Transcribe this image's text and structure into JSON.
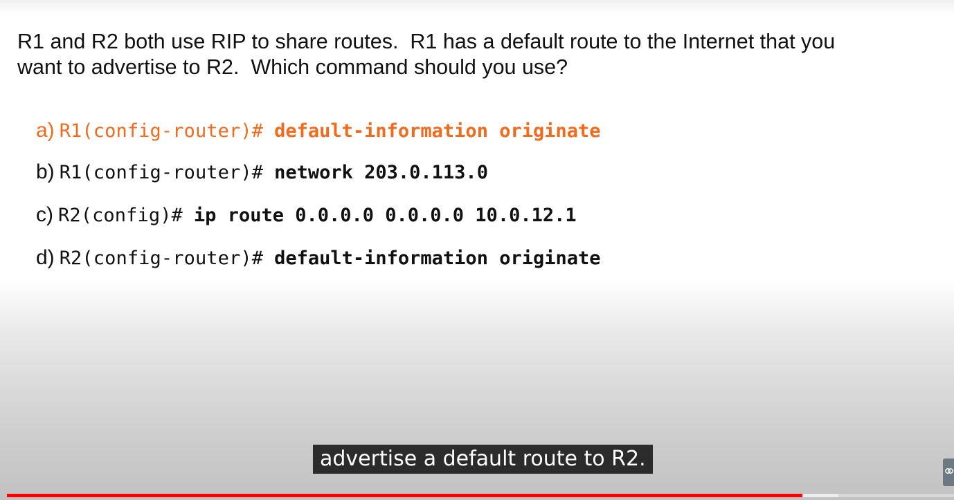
{
  "question": {
    "text": "R1 and R2 both use RIP to share routes.  R1 has a default route to the Internet that you\nwant to advertise to R2.  Which command should you use?"
  },
  "options": [
    {
      "letter": "a)",
      "prompt": "R1(config-router)#",
      "command": "default-information originate",
      "highlighted": true
    },
    {
      "letter": "b)",
      "prompt": "R1(config-router)#",
      "command": "network 203.0.113.0",
      "highlighted": false
    },
    {
      "letter": "c)",
      "prompt": "R2(config)#",
      "command": "ip route 0.0.0.0 0.0.0.0 10.0.12.1",
      "highlighted": false
    },
    {
      "letter": "d)",
      "prompt": "R2(config-router)#",
      "command": "default-information originate",
      "highlighted": false
    }
  ],
  "subtitle": {
    "text": "advertise a default route to R2."
  },
  "player": {
    "progress_fraction": 0.84,
    "accent_color": "#ff0000",
    "side_widget_icon": "cloud-link-icon"
  },
  "colors": {
    "correct_answer": "#f26a1b",
    "text": "#111111"
  }
}
